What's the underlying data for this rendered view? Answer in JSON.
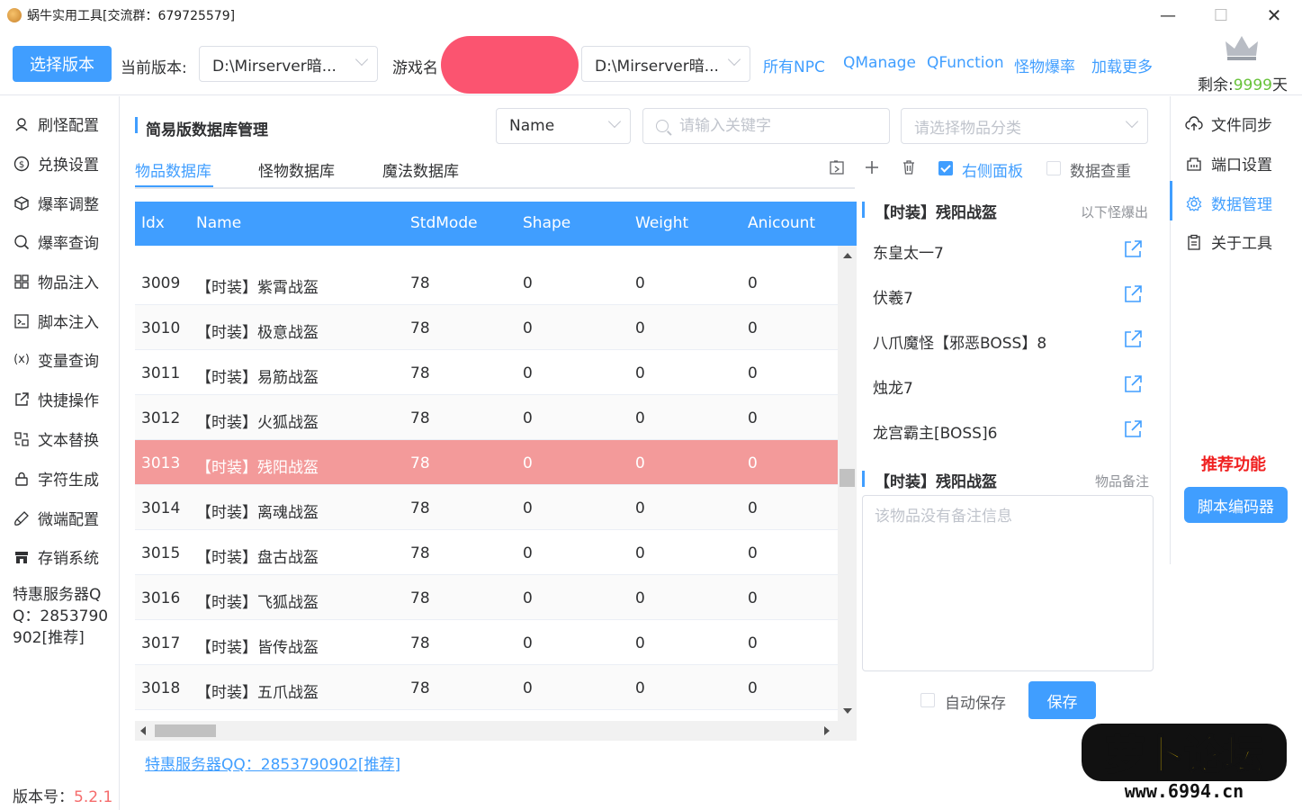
{
  "window": {
    "title": "蜗牛实用工具[交流群：679725579]",
    "controls": {
      "minimize": "—",
      "maximize": "☐",
      "close": "✕"
    }
  },
  "toolbar": {
    "select_version_label": "选择版本",
    "current_version_label": "当前版本:",
    "current_version_value": "D:\\Mirserver暗...",
    "game_name_label": "游戏名",
    "game_path_value": "D:\\Mirserver暗...",
    "links": [
      "所有NPC",
      "QManage",
      "QFunction",
      "怪物爆率",
      "加载更多"
    ],
    "remaining_prefix": "剩余:",
    "remaining_value": "9999",
    "remaining_suffix": "天"
  },
  "sidebar": {
    "items": [
      {
        "label": "刷怪配置",
        "icon": "monster-icon"
      },
      {
        "label": "兑换设置",
        "icon": "dollar-icon"
      },
      {
        "label": "爆率调整",
        "icon": "box-icon"
      },
      {
        "label": "爆率查询",
        "icon": "search-icon"
      },
      {
        "label": "物品注入",
        "icon": "grid-icon"
      },
      {
        "label": "脚本注入",
        "icon": "terminal-icon"
      },
      {
        "label": "变量查询",
        "icon": "variable-icon"
      },
      {
        "label": "快捷操作",
        "icon": "external-link-icon"
      },
      {
        "label": "文本替换",
        "icon": "replace-icon"
      },
      {
        "label": "字符生成",
        "icon": "lock-icon"
      },
      {
        "label": "微端配置",
        "icon": "brush-icon"
      },
      {
        "label": "存销系统",
        "icon": "store-icon"
      }
    ],
    "promo": "特惠服务器QQ：2853790902[推荐]",
    "version_label": "版本号：",
    "version_value": "5.2.1"
  },
  "main": {
    "section_title": "简易版数据库管理",
    "field_select": "Name",
    "search_placeholder": "请输入关键字",
    "category_placeholder": "请选择物品分类",
    "tabs": [
      "物品数据库",
      "怪物数据库",
      "魔法数据库"
    ],
    "active_tab": 0,
    "right_panel_label": "右侧面板",
    "right_panel_checked": true,
    "dedupe_label": "数据查重",
    "dedupe_checked": false,
    "table": {
      "columns": [
        "Idx",
        "Name",
        "StdMode",
        "Shape",
        "Weight",
        "Anicount"
      ],
      "rows": [
        [
          "3009",
          "【时装】紫霄战盔",
          "78",
          "0",
          "0",
          "0"
        ],
        [
          "3010",
          "【时装】极意战盔",
          "78",
          "0",
          "0",
          "0"
        ],
        [
          "3011",
          "【时装】易筋战盔",
          "78",
          "0",
          "0",
          "0"
        ],
        [
          "3012",
          "【时装】火狐战盔",
          "78",
          "0",
          "0",
          "0"
        ],
        [
          "3013",
          "【时装】残阳战盔",
          "78",
          "0",
          "0",
          "0"
        ],
        [
          "3014",
          "【时装】离魂战盔",
          "78",
          "0",
          "0",
          "0"
        ],
        [
          "3015",
          "【时装】盘古战盔",
          "78",
          "0",
          "0",
          "0"
        ],
        [
          "3016",
          "【时装】飞狐战盔",
          "78",
          "0",
          "0",
          "0"
        ],
        [
          "3017",
          "【时装】皆传战盔",
          "78",
          "0",
          "0",
          "0"
        ],
        [
          "3018",
          "【时装】五爪战盔",
          "78",
          "0",
          "0",
          "0"
        ]
      ],
      "selected_index": 4
    },
    "footer_link": "特惠服务器QQ：2853790902[推荐]"
  },
  "detail": {
    "drops_title": "【时装】残阳战盔",
    "drops_subtitle": "以下怪爆出",
    "drops": [
      "东皇太一7",
      "伏羲7",
      "八爪魔怪【邪恶BOSS】8",
      "烛龙7",
      "龙宫霸主[BOSS]6"
    ],
    "note_title": "【时装】残阳战盔",
    "note_subtitle": "物品备注",
    "note_placeholder": "该物品没有备注信息",
    "autosave_label": "自动保存",
    "save_label": "保存"
  },
  "right_nav": {
    "items": [
      {
        "label": "文件同步",
        "icon": "cloud-upload-icon"
      },
      {
        "label": "端口设置",
        "icon": "port-icon"
      },
      {
        "label": "数据管理",
        "icon": "gear-icon"
      },
      {
        "label": "关于工具",
        "icon": "clipboard-icon"
      }
    ],
    "active_index": 2,
    "recommend_label": "推荐功能",
    "script_encoder_label": "脚本编码器"
  },
  "colors": {
    "accent": "#409eff",
    "selected_row": "#f39a9a",
    "remaining": "#67c23a",
    "version": "#f56c6c",
    "recommend": "#f02020"
  }
}
